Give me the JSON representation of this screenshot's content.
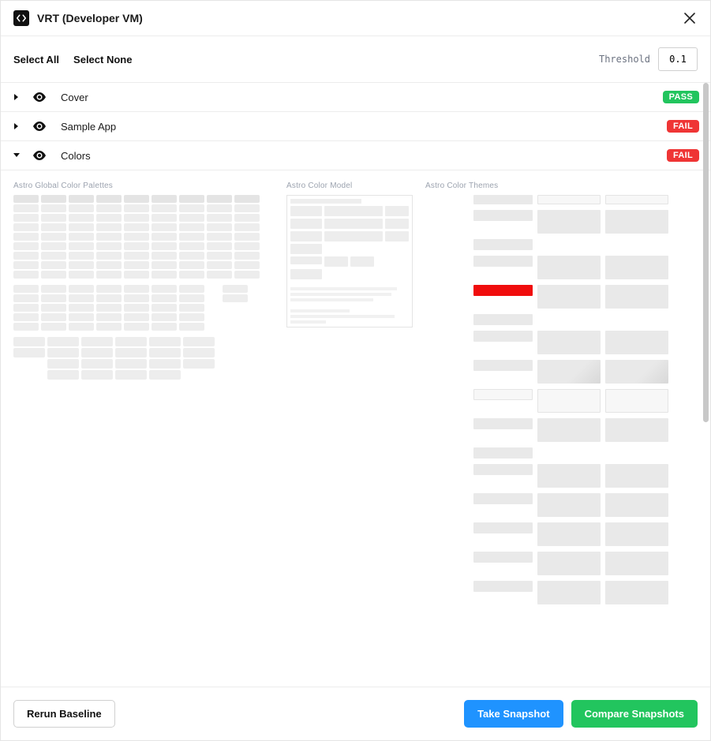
{
  "header": {
    "title": "VRT (Developer VM)"
  },
  "controls": {
    "select_all": "Select All",
    "select_none": "Select None",
    "threshold_label": "Threshold",
    "threshold_value": "0.1"
  },
  "items": [
    {
      "name": "Cover",
      "status": "PASS",
      "status_class": "pass",
      "expanded": false
    },
    {
      "name": "Sample App",
      "status": "FAIL",
      "status_class": "fail",
      "expanded": false
    },
    {
      "name": "Colors",
      "status": "FAIL",
      "status_class": "fail",
      "expanded": true
    }
  ],
  "expanded_panels": {
    "panel_a_title": "Astro Global Color Palettes",
    "panel_b_title": "Astro Color Model",
    "panel_c_title": "Astro Color Themes"
  },
  "footer": {
    "rerun": "Rerun Baseline",
    "take_snapshot": "Take Snapshot",
    "compare": "Compare Snapshots"
  },
  "colors": {
    "pass": "#22c55e",
    "fail": "#ef3535",
    "primary": "#1f93ff",
    "success": "#22c55e",
    "highlight": "#f00d0d"
  }
}
